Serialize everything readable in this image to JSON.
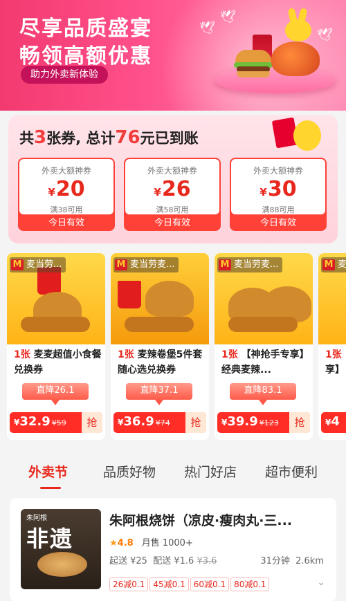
{
  "banner": {
    "headline1": "尽享品质盛宴",
    "headline2": "畅领高额优惠",
    "pill": "助力外卖新体验"
  },
  "coupon_summary": {
    "prefix": "共",
    "count": "3",
    "mid": "张券, 总计",
    "total": "76",
    "suffix": "元已到账"
  },
  "coupons": [
    {
      "title": "外卖大额神券",
      "currency": "¥",
      "amount": "20",
      "condition": "满38可用",
      "validity": "今日有效"
    },
    {
      "title": "外卖大额神券",
      "currency": "¥",
      "amount": "26",
      "condition": "满58可用",
      "validity": "今日有效"
    },
    {
      "title": "外卖大额神券",
      "currency": "¥",
      "amount": "30",
      "condition": "满88可用",
      "validity": "今日有效"
    }
  ],
  "products": [
    {
      "brand": "麦当劳...",
      "qty": "1张",
      "name": "麦麦超值小食餐兑换券",
      "drop": "直降26.1",
      "currency": "¥",
      "price": "32.9",
      "orig": "¥59",
      "grab": "抢"
    },
    {
      "brand": "麦当劳麦...",
      "qty": "1张",
      "name": "麦辣卷堡5件套随心选兑换券",
      "drop": "直降37.1",
      "currency": "¥",
      "price": "36.9",
      "orig": "¥74",
      "grab": "抢"
    },
    {
      "brand": "麦当劳麦...",
      "qty": "1张",
      "name": "【神抢手专享】经典麦辣...",
      "drop": "直降83.1",
      "currency": "¥",
      "price": "39.9",
      "orig": "¥123",
      "grab": "抢"
    },
    {
      "brand": "麦",
      "qty": "1张",
      "name": "享】",
      "drop": "",
      "currency": "¥",
      "price": "4",
      "orig": "",
      "grab": ""
    }
  ],
  "tabs": [
    {
      "label": "外卖节",
      "active": true
    },
    {
      "label": "品质好物",
      "active": false
    },
    {
      "label": "热门好店",
      "active": false
    },
    {
      "label": "超市便利",
      "active": false
    }
  ],
  "store": {
    "name": "朱阿根烧饼（凉皮·瘦肉丸·三...",
    "thumb_brand": "朱阿根",
    "thumb_text": "非遗",
    "rating": "4.8",
    "monthly_label": "月售",
    "monthly_value": "1000+",
    "min_order": "起送 ¥25",
    "delivery_label": "配送 ¥1.6",
    "delivery_orig": "¥3.6",
    "time": "31分钟",
    "distance": "2.6km",
    "tags": [
      "26减0.1",
      "45减0.1",
      "60减0.1",
      "80减0.1"
    ]
  }
}
